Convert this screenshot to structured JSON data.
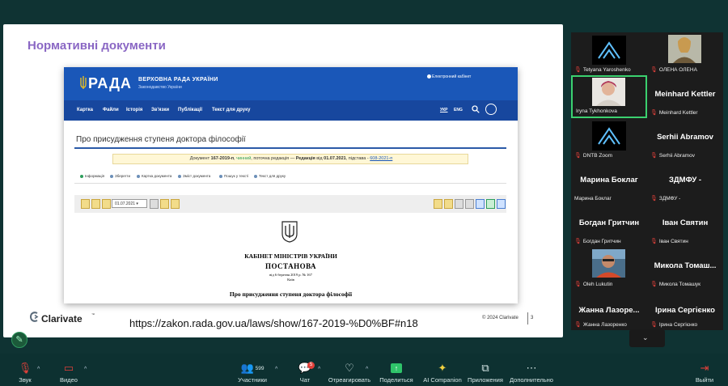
{
  "slide": {
    "title": "Нормативні документи",
    "url": "https://zakon.rada.gov.ua/laws/show/167-2019-%D0%BF#n18",
    "brand": "Clarivate",
    "brand_tm": "™",
    "copyright": "© 2024 Clarivate",
    "page_number": "3"
  },
  "rada": {
    "logo": "РАДА",
    "name": "ВЕРХОВНА РАДА УКРАЇНИ",
    "sub": "Законодавство України",
    "cabinet": "Електронний кабінет",
    "nav": [
      "Картка",
      "Файли",
      "Історія",
      "Зв'язки",
      "Публікації",
      "Текст для друку"
    ],
    "lang_ukr": "УКР",
    "lang_eng": "ENG",
    "doc_title": "Про присудження ступеня доктора філософії",
    "doc_meta_pre": "Документ ",
    "doc_meta_num": "167-2019-п",
    "doc_meta_sep": ", ",
    "doc_meta_status": "чинний",
    "doc_meta_mid": ", поточна редакція — ",
    "doc_meta_red": "Редакція",
    "doc_meta_from": " від ",
    "doc_meta_date": "01.07.2021",
    "doc_meta_basis": ", підстава - ",
    "doc_meta_basis_link": "608-2021-п",
    "tabs": [
      "Інформація",
      "Зберегти",
      "Картка документа",
      "Зміст документа",
      "Пошук у тексті",
      "Текст для друку"
    ],
    "date_select": "01.07.2021 ▾",
    "gov_cabinet": "КАБІНЕТ МІНІСТРІВ УКРАЇНИ",
    "gov_post": "ПОСТАНОВА",
    "gov_date": "від 6 березня 2019 р. № 167",
    "gov_city": "Київ",
    "gov_doc_title": "Про присудження ступеня доктора філософії"
  },
  "participants": [
    {
      "label": "Tetyana Yaroshenko",
      "type": "logo"
    },
    {
      "label": "ОЛЕНА ОЛЕНА",
      "type": "photo"
    },
    {
      "label": "Iryna Tykhonkova",
      "type": "photo",
      "active": true
    },
    {
      "label": "Meinhard Kettler",
      "big": "Meinhard Kettler",
      "type": "name"
    },
    {
      "label": "DNTB Zoom",
      "type": "logo"
    },
    {
      "label": "Serhii Abramov",
      "big": "Serhii Abramov",
      "type": "name"
    },
    {
      "label": "Марина Боклаг",
      "big": "Марина Боклаг",
      "type": "name"
    },
    {
      "label": "ЗДМФУ -",
      "big": "ЗДМФУ -",
      "type": "name"
    },
    {
      "label": "Богдан Гритчин",
      "big": "Богдан Гритчин",
      "type": "name"
    },
    {
      "label": "Іван Святин",
      "big": "Іван Святин",
      "type": "name"
    },
    {
      "label": "Oleh Lukutin",
      "type": "photo"
    },
    {
      "label": "Микола Томашук",
      "big": "Микола Томаш...",
      "type": "name"
    },
    {
      "label": "Жанна Лазоренко",
      "big": "Жанна Лазоре...",
      "type": "name"
    },
    {
      "label": "Ірина Сергієнко",
      "big": "Ірина Сергієнко",
      "type": "name"
    }
  ],
  "toolbar": {
    "mute": "Звук",
    "video": "Видео",
    "participants_count": "599",
    "participants": "Участники",
    "chat_badge": "5",
    "chat": "Чат",
    "react": "Отреагировать",
    "share": "Поделиться",
    "ai": "AI Companion",
    "apps": "Приложения",
    "more": "Дополнительно",
    "leave": "Выйти"
  },
  "colors": {
    "accent_green": "#3bd16f",
    "rada_blue": "#1a57b8",
    "slide_title": "#8a67c4",
    "mic_muted": "#e0403a"
  }
}
